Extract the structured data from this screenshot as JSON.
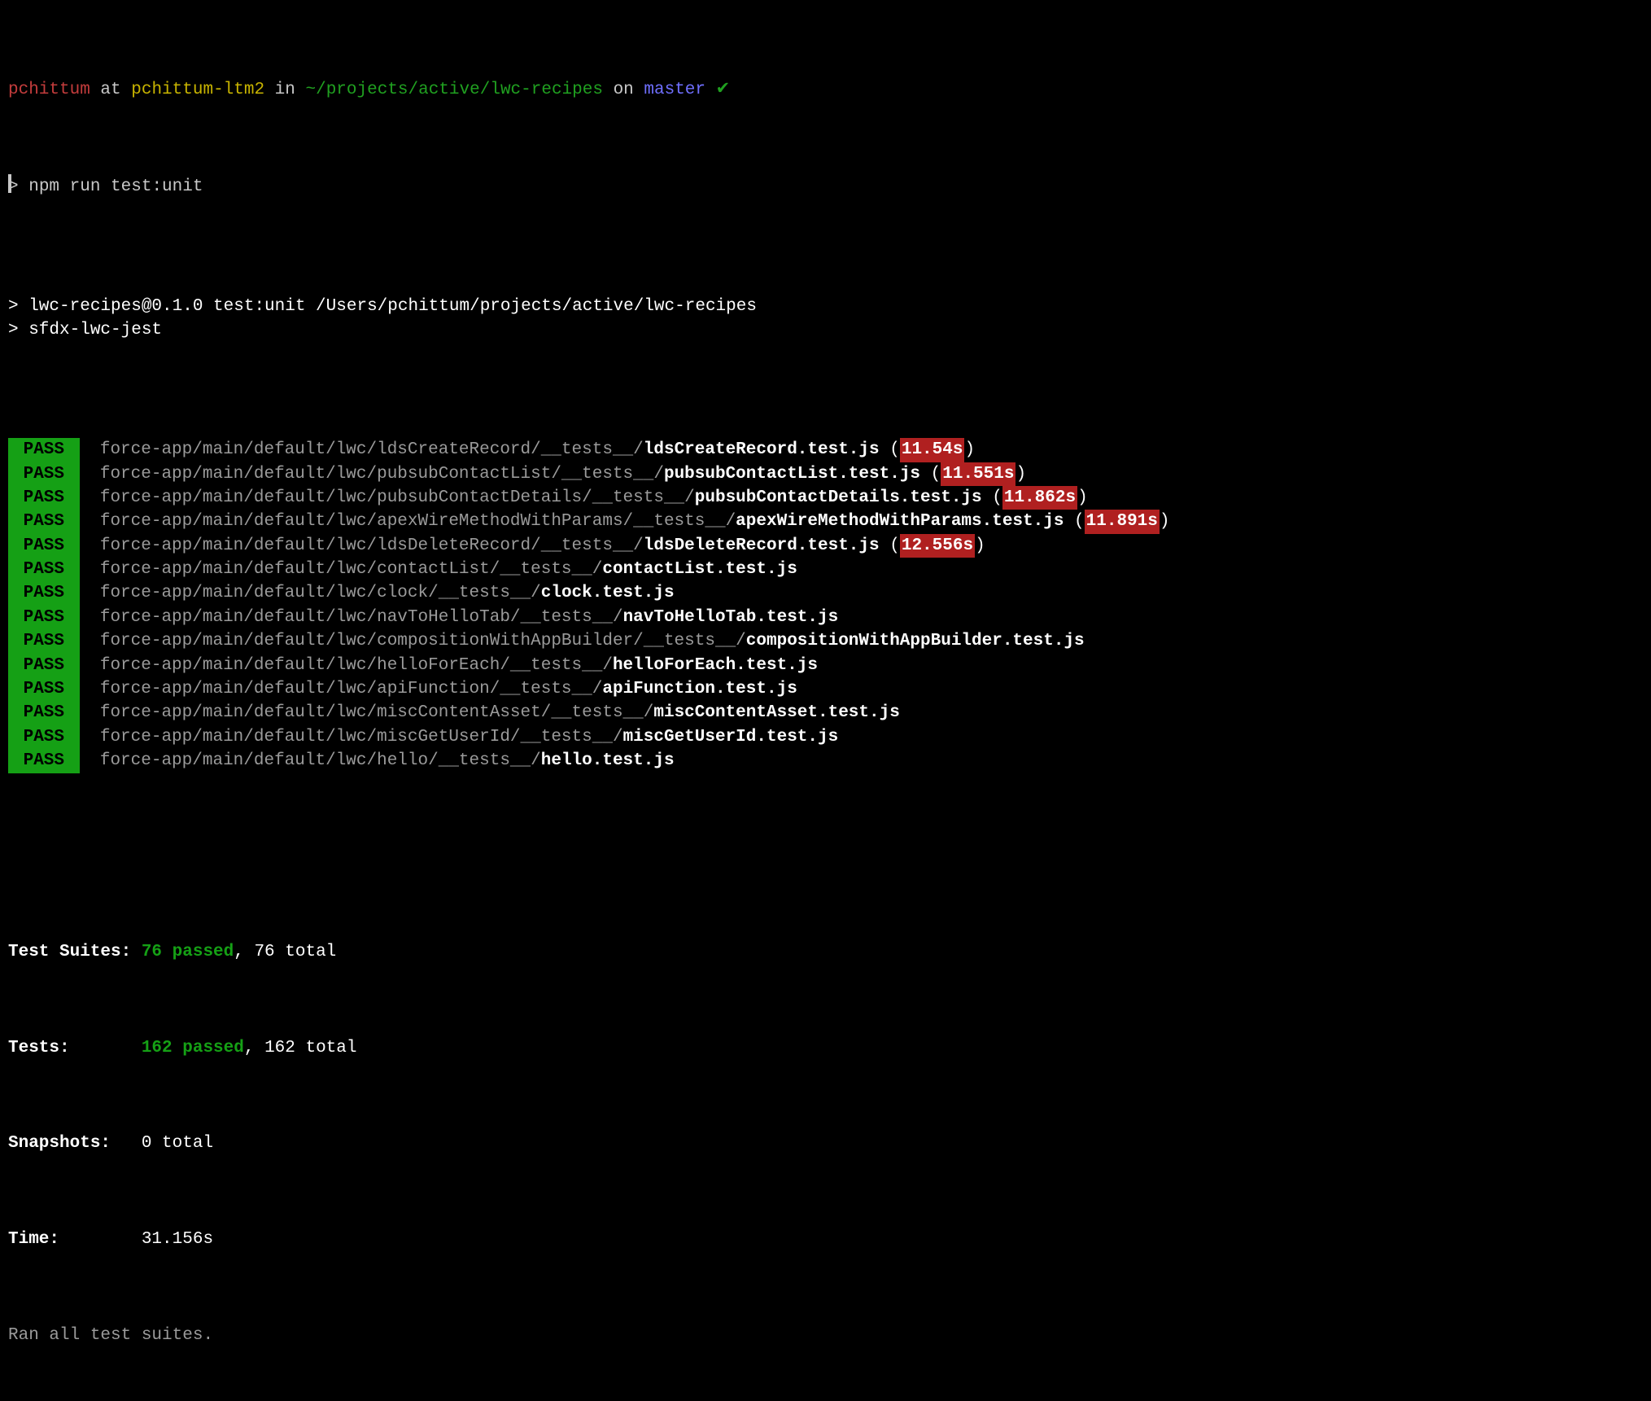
{
  "prompt": {
    "user": "pchittum",
    "at": " at ",
    "host": "pchittum-ltm2",
    "in": " in ",
    "path": "~/projects/active/lwc-recipes",
    "on": " on ",
    "branch": "master",
    "status_icon": " ✔",
    "ps1": "> ",
    "command": "npm run test:unit"
  },
  "script_lines": [
    "",
    "> lwc-recipes@0.1.0 test:unit /Users/pchittum/projects/active/lwc-recipes",
    "> sfdx-lwc-jest",
    ""
  ],
  "results": [
    {
      "status": "PASS",
      "path": "force-app/main/default/lwc/ldsCreateRecord/__tests__/",
      "file": "ldsCreateRecord.test.js",
      "time": "11.54s"
    },
    {
      "status": "PASS",
      "path": "force-app/main/default/lwc/pubsubContactList/__tests__/",
      "file": "pubsubContactList.test.js",
      "time": "11.551s"
    },
    {
      "status": "PASS",
      "path": "force-app/main/default/lwc/pubsubContactDetails/__tests__/",
      "file": "pubsubContactDetails.test.js",
      "time": "11.862s"
    },
    {
      "status": "PASS",
      "path": "force-app/main/default/lwc/apexWireMethodWithParams/__tests__/",
      "file": "apexWireMethodWithParams.test.js",
      "time": "11.891s"
    },
    {
      "status": "PASS",
      "path": "force-app/main/default/lwc/ldsDeleteRecord/__tests__/",
      "file": "ldsDeleteRecord.test.js",
      "time": "12.556s"
    },
    {
      "status": "PASS",
      "path": "force-app/main/default/lwc/contactList/__tests__/",
      "file": "contactList.test.js"
    },
    {
      "status": "PASS",
      "path": "force-app/main/default/lwc/clock/__tests__/",
      "file": "clock.test.js"
    },
    {
      "status": "PASS",
      "path": "force-app/main/default/lwc/navToHelloTab/__tests__/",
      "file": "navToHelloTab.test.js"
    },
    {
      "status": "PASS",
      "path": "force-app/main/default/lwc/compositionWithAppBuilder/__tests__/",
      "file": "compositionWithAppBuilder.test.js"
    },
    {
      "status": "PASS",
      "path": "force-app/main/default/lwc/helloForEach/__tests__/",
      "file": "helloForEach.test.js"
    },
    {
      "status": "PASS",
      "path": "force-app/main/default/lwc/apiFunction/__tests__/",
      "file": "apiFunction.test.js"
    },
    {
      "status": "PASS",
      "path": "force-app/main/default/lwc/miscContentAsset/__tests__/",
      "file": "miscContentAsset.test.js"
    },
    {
      "status": "PASS",
      "path": "force-app/main/default/lwc/miscGetUserId/__tests__/",
      "file": "miscGetUserId.test.js"
    },
    {
      "status": "PASS",
      "path": "force-app/main/default/lwc/hello/__tests__/",
      "file": "hello.test.js"
    }
  ],
  "summary": {
    "suites_label": "Test Suites: ",
    "suites_passed": "76 passed",
    "suites_total": ", 76 total",
    "tests_label": "Tests:       ",
    "tests_passed": "162 passed",
    "tests_total": ", 162 total",
    "snapshots_label": "Snapshots:   ",
    "snapshots_value": "0 total",
    "time_label": "Time:        ",
    "time_value": "31.156s",
    "ran": "Ran all test suites."
  }
}
